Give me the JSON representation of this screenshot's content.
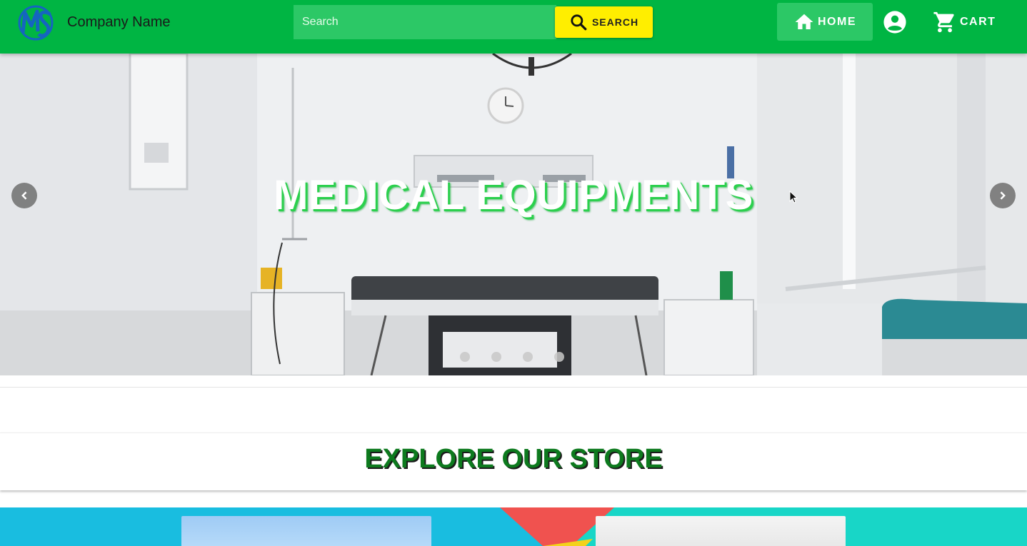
{
  "header": {
    "company_name": "Company Name",
    "search_placeholder": "Search",
    "search_label": "SEARCH",
    "home_label": "HOME",
    "cart_label": "CART",
    "colors": {
      "bar": "#00b543",
      "search_button": "#ffee00"
    }
  },
  "hero": {
    "title": "MEDICAL EQUIPMENTS",
    "slide_count": 4,
    "icons": {
      "prev": "chevron-left-icon",
      "next": "chevron-right-icon"
    }
  },
  "explore": {
    "title": "EXPLORE OUR STORE"
  }
}
